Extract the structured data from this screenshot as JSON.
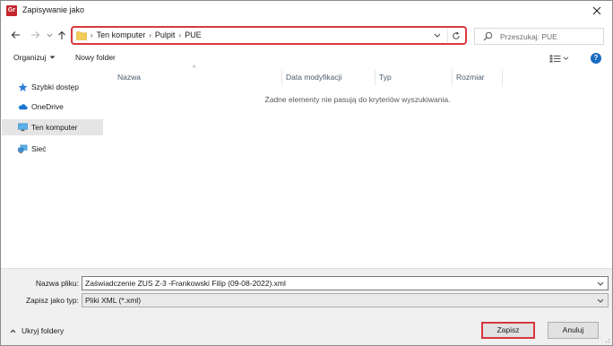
{
  "window": {
    "title": "Zapisywanie jako",
    "app_icon_text": "Gr"
  },
  "address": {
    "crumbs": [
      "Ten komputer",
      "Pulpit",
      "PUE"
    ]
  },
  "search": {
    "placeholder": "Przeszukaj: PUE"
  },
  "toolbar": {
    "organize_label": "Organizuj",
    "new_folder_label": "Nowy folder"
  },
  "nav": {
    "items": [
      {
        "label": "Szybki dostęp",
        "icon": "star-icon"
      },
      {
        "label": "OneDrive",
        "icon": "cloud-icon"
      },
      {
        "label": "Ten komputer",
        "icon": "computer-icon",
        "selected": true
      },
      {
        "label": "Sieć",
        "icon": "network-icon"
      }
    ]
  },
  "columns": [
    "Nazwa",
    "Data modyfikacji",
    "Typ",
    "Rozmiar"
  ],
  "empty_message": "Żadne elementy nie pasują do kryteriów wyszukiwania.",
  "form": {
    "filename_label": "Nazwa pliku:",
    "filename_value": "Zaświadczenie ZUS Z-3 -Frankowski Filip (09-08-2022).xml",
    "filetype_label": "Zapisz jako typ:",
    "filetype_value": "Pliki XML (*.xml)"
  },
  "footer": {
    "hide_folders_label": "Ukryj foldery",
    "save_label": "Zapisz",
    "cancel_label": "Anuluj"
  },
  "colors": {
    "highlight": "#d8383c",
    "accent": "#1a6bc2",
    "app_icon": "#c4262e"
  }
}
